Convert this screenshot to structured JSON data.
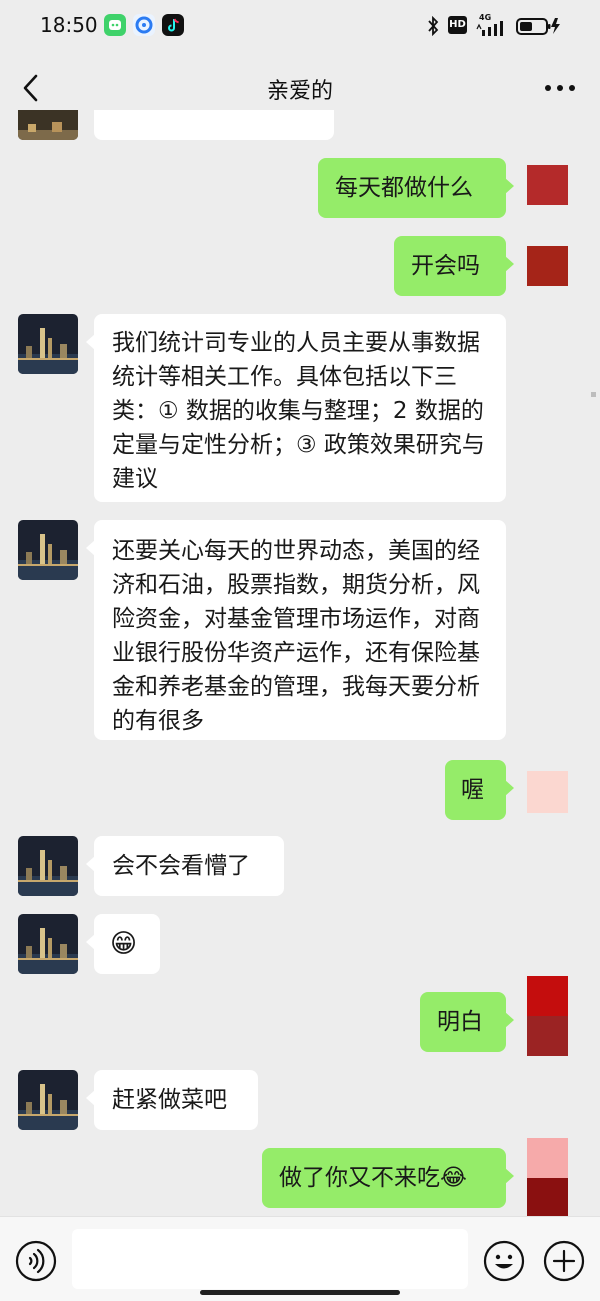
{
  "status_bar": {
    "time": "18:50",
    "icons": [
      "wechat-mini-icon",
      "browser-icon",
      "tiktok-icon"
    ],
    "right_icons": [
      "bluetooth-icon",
      "hd-icon",
      "4g-signal-icon",
      "battery-icon"
    ],
    "hd_label": "HD",
    "network_label": "4G"
  },
  "header": {
    "title": "亲爱的"
  },
  "messages": [
    {
      "dir": "out",
      "text": "每天都做什么"
    },
    {
      "dir": "out",
      "text": "开会吗"
    },
    {
      "dir": "in",
      "text": "我们统计司专业的人员主要从事数据统计等相关工作。具体包括以下三类：① 数据的收集与整理；2 数据的定量与定性分析；③ 政策效果研究与建议"
    },
    {
      "dir": "in",
      "text": "还要关心每天的世界动态，美国的经济和石油，股票指数，期货分析，风险资金，对基金管理市场运作，对商业银行股份华资产运作，还有保险基金和养老基金的管理，我每天要分析的有很多"
    },
    {
      "dir": "out",
      "text": "喔"
    },
    {
      "dir": "in",
      "text": "会不会看懵了"
    },
    {
      "dir": "in",
      "text": "😁"
    },
    {
      "dir": "out",
      "text": "明白"
    },
    {
      "dir": "in",
      "text": "赶紧做菜吧"
    },
    {
      "dir": "out",
      "text": "做了你又不来吃😂"
    }
  ],
  "colors": {
    "background": "#ededed",
    "outgoing_bubble": "#95ec69",
    "incoming_bubble": "#ffffff"
  },
  "input_bar": {
    "placeholder": ""
  }
}
